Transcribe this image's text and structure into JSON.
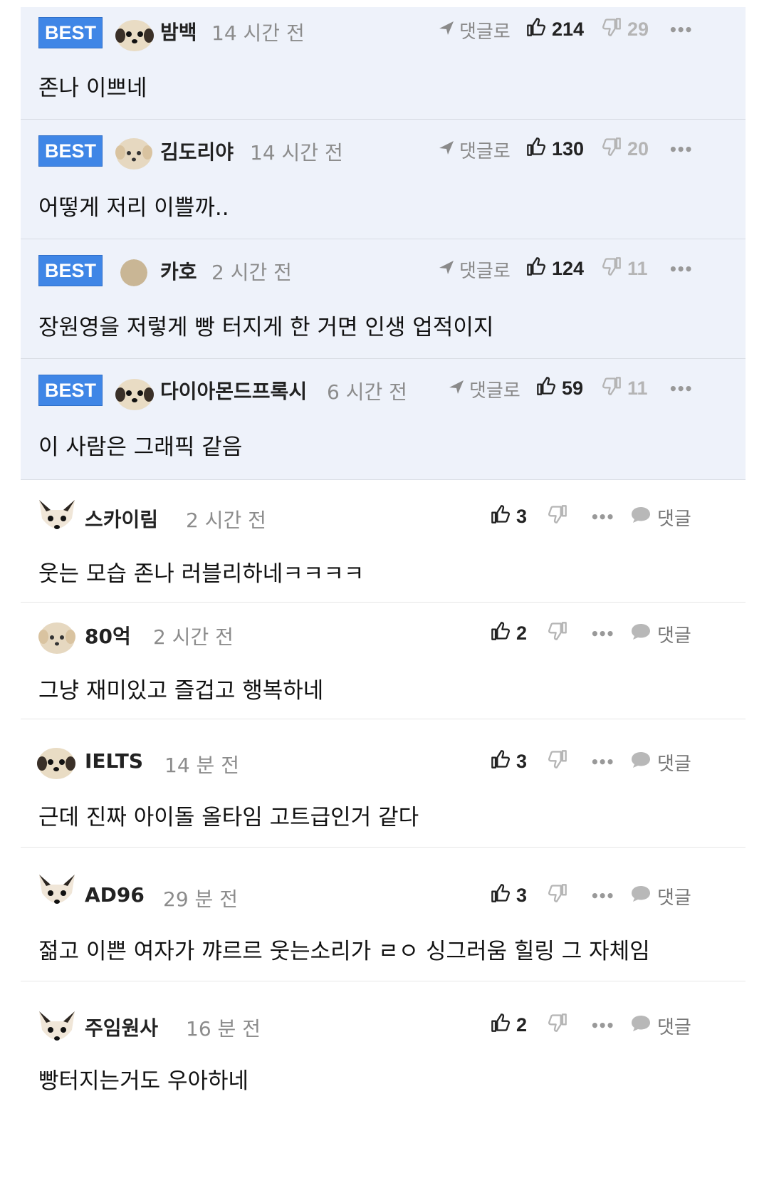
{
  "best_label": "BEST",
  "reply_to_label": "댓글로",
  "reply_label": "댓글",
  "more_glyph": "•••",
  "colors": {
    "best_bg": "#eef2fa",
    "badge": "#3f86e6",
    "muted": "#8c8c8c"
  },
  "best_comments": [
    {
      "user": "밤백",
      "time": "14 시간 전",
      "text": "존나 이쁘네",
      "up": "214",
      "down": "29",
      "avatar": "pug"
    },
    {
      "user": "김도리야",
      "time": "14 시간 전",
      "text": "어떻게 저리 이쁠까..",
      "up": "130",
      "down": "20",
      "avatar": "puppy"
    },
    {
      "user": "카호",
      "time": "2 시간 전",
      "text": "장원영을 저렇게 빵 터지게 한 거면 인생 업적이지",
      "up": "124",
      "down": "11",
      "avatar": "circle"
    },
    {
      "user": "다이아몬드프록시",
      "time": "6 시간 전",
      "text": "이 사람은 그래픽 같음",
      "up": "59",
      "down": "11",
      "avatar": "pug"
    }
  ],
  "comments": [
    {
      "user": "스카이림",
      "time": "2 시간 전",
      "text": "웃는 모습 존나 러블리하네ㅋㅋㅋㅋ",
      "up": "3",
      "avatar": "fox"
    },
    {
      "user": "80억",
      "time": "2 시간 전",
      "text": "그냥 재미있고 즐겁고 행복하네",
      "up": "2",
      "avatar": "puppy"
    },
    {
      "user": "IELTS",
      "time": "14 분 전",
      "text": "근데 진짜 아이돌 올타임 고트급인거 같다",
      "up": "3",
      "avatar": "pug"
    },
    {
      "user": "AD96",
      "time": "29 분 전",
      "text": "젊고 이쁜 여자가 꺄르르 웃는소리가 ㄹㅇ 싱그러움 힐링 그 자체임",
      "up": "3",
      "avatar": "fox"
    },
    {
      "user": "주임원사",
      "time": "16 분 전",
      "text": "빵터지는거도 우아하네",
      "up": "2",
      "avatar": "fox"
    }
  ]
}
